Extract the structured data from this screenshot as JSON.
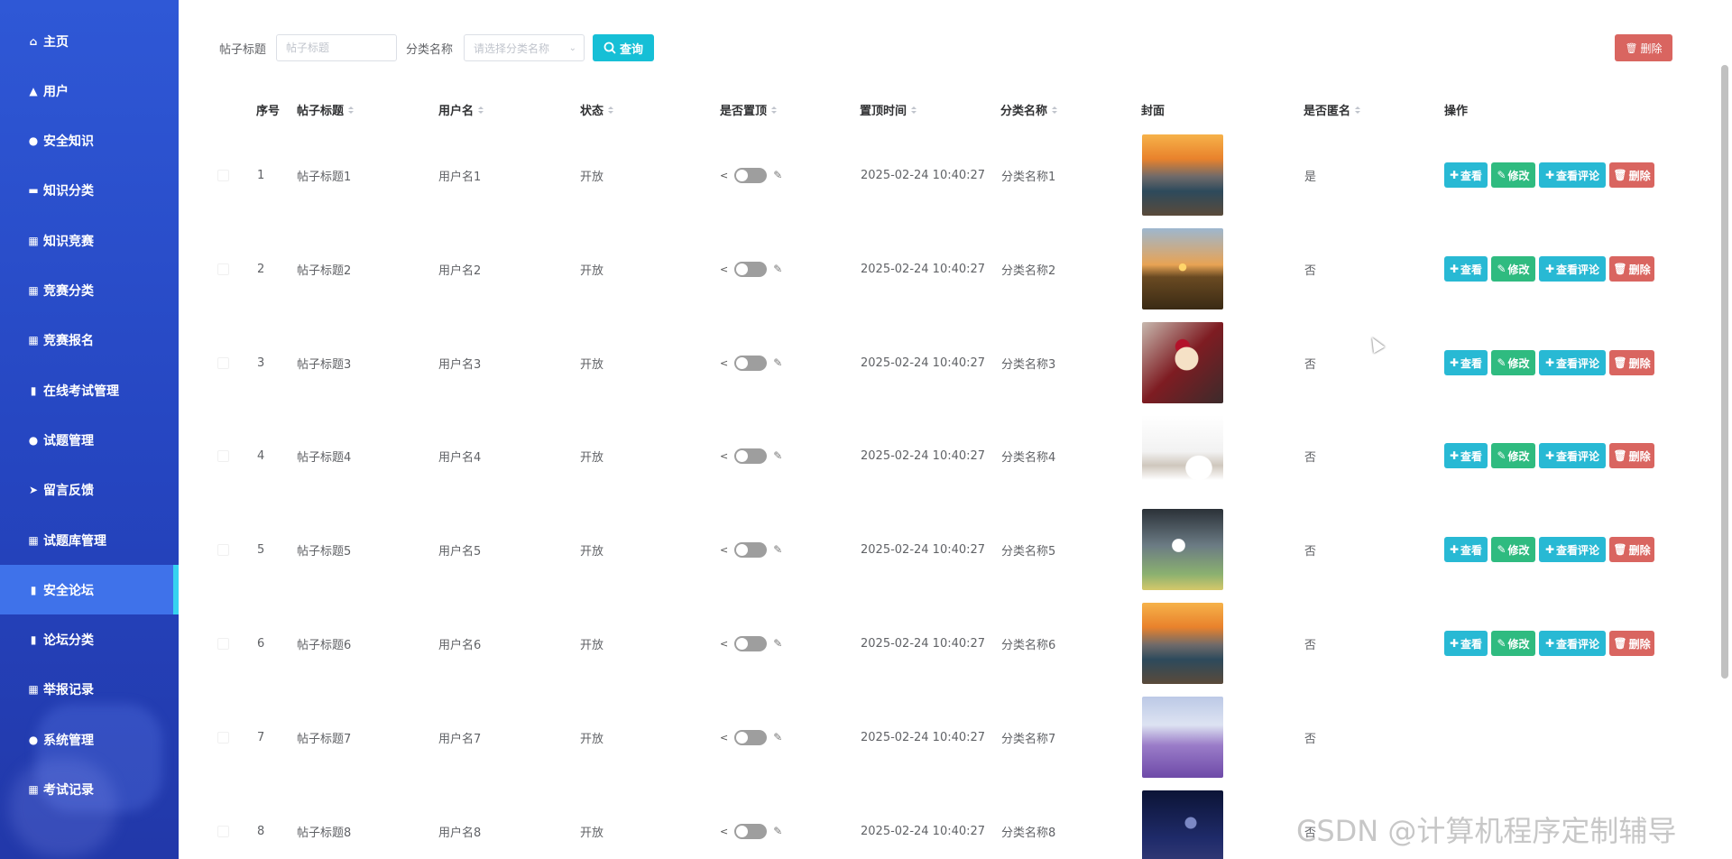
{
  "sidebar": {
    "items": [
      {
        "label": "主页",
        "icon": "home-icon",
        "glyph": "⌂",
        "active": false
      },
      {
        "label": "用户",
        "icon": "bank-icon",
        "glyph": "▲",
        "active": false
      },
      {
        "label": "安全知识",
        "icon": "user-icon",
        "glyph": "●",
        "active": false
      },
      {
        "label": "知识分类",
        "icon": "monitor-icon",
        "glyph": "▬",
        "active": false
      },
      {
        "label": "知识竞赛",
        "icon": "grid-icon",
        "glyph": "▦",
        "active": false
      },
      {
        "label": "竞赛分类",
        "icon": "grid-icon",
        "glyph": "▦",
        "active": false
      },
      {
        "label": "竞赛报名",
        "icon": "grid-icon",
        "glyph": "▦",
        "active": false
      },
      {
        "label": "在线考试管理",
        "icon": "clipboard-icon",
        "glyph": "▮",
        "active": false
      },
      {
        "label": "试题管理",
        "icon": "bulb-icon",
        "glyph": "●",
        "active": false
      },
      {
        "label": "留言反馈",
        "icon": "send-icon",
        "glyph": "➤",
        "active": false
      },
      {
        "label": "试题库管理",
        "icon": "grid-icon",
        "glyph": "▦",
        "active": false
      },
      {
        "label": "安全论坛",
        "icon": "clipboard-icon",
        "glyph": "▮",
        "active": true
      },
      {
        "label": "论坛分类",
        "icon": "chart-icon",
        "glyph": "▮",
        "active": false
      },
      {
        "label": "举报记录",
        "icon": "grid-icon",
        "glyph": "▦",
        "active": false
      },
      {
        "label": "系统管理",
        "icon": "user-icon",
        "glyph": "●",
        "active": false
      },
      {
        "label": "考试记录",
        "icon": "grid-icon",
        "glyph": "▦",
        "active": false
      }
    ]
  },
  "search": {
    "title_label": "帖子标题",
    "title_placeholder": "帖子标题",
    "category_label": "分类名称",
    "category_placeholder": "请选择分类名称",
    "query_button": "查询",
    "delete_button": "删除"
  },
  "table": {
    "headers": {
      "index": "序号",
      "title": "帖子标题",
      "username": "用户名",
      "status": "状态",
      "pinned": "是否置顶",
      "pin_time": "置顶时间",
      "category": "分类名称",
      "cover": "封面",
      "anonymous": "是否匿名",
      "actions": "操作"
    },
    "action_labels": {
      "view": "查看",
      "edit": "修改",
      "view_comments": "查看评论",
      "delete": "删除"
    },
    "rows": [
      {
        "index": "1",
        "title": "帖子标题1",
        "username": "用户名1",
        "status": "开放",
        "pin_time": "2025-02-24 10:40:27",
        "category": "分类名称1",
        "cover": "sunset-sea",
        "anonymous": "是",
        "show_actions": true
      },
      {
        "index": "2",
        "title": "帖子标题2",
        "username": "用户名2",
        "status": "开放",
        "pin_time": "2025-02-24 10:40:27",
        "category": "分类名称2",
        "cover": "sunset-grass",
        "anonymous": "否",
        "show_actions": true
      },
      {
        "index": "3",
        "title": "帖子标题3",
        "username": "用户名3",
        "status": "开放",
        "pin_time": "2025-02-24 10:40:27",
        "category": "分类名称3",
        "cover": "cake-berries",
        "anonymous": "否",
        "show_actions": true
      },
      {
        "index": "4",
        "title": "帖子标题4",
        "username": "用户名4",
        "status": "开放",
        "pin_time": "2025-02-24 10:40:27",
        "category": "分类名称4",
        "cover": "book-coffee",
        "anonymous": "否",
        "show_actions": true
      },
      {
        "index": "5",
        "title": "帖子标题5",
        "username": "用户名5",
        "status": "开放",
        "pin_time": "2025-02-24 10:40:27",
        "category": "分类名称5",
        "cover": "football",
        "anonymous": "否",
        "show_actions": true
      },
      {
        "index": "6",
        "title": "帖子标题6",
        "username": "用户名6",
        "status": "开放",
        "pin_time": "2025-02-24 10:40:27",
        "category": "分类名称6",
        "cover": "sunset-sea",
        "anonymous": "否",
        "show_actions": true
      },
      {
        "index": "7",
        "title": "帖子标题7",
        "username": "用户名7",
        "status": "开放",
        "pin_time": "2025-02-24 10:40:27",
        "category": "分类名称7",
        "cover": "lavender",
        "anonymous": "否",
        "show_actions": false
      },
      {
        "index": "8",
        "title": "帖子标题8",
        "username": "用户名8",
        "status": "开放",
        "pin_time": "2025-02-24 10:40:27",
        "category": "分类名称8",
        "cover": "night-sky",
        "anonymous": "否",
        "show_actions": false
      }
    ]
  },
  "watermark": "CSDN @计算机程序定制辅导",
  "colors": {
    "sidebar": "#2f58d6",
    "active_item": "#3f72ea",
    "active_indicator": "#35d3f0",
    "query_button": "#16bfd6",
    "delete_button": "#d96560",
    "edit_button": "#2fbb80",
    "view_button": "#28b9d4"
  }
}
